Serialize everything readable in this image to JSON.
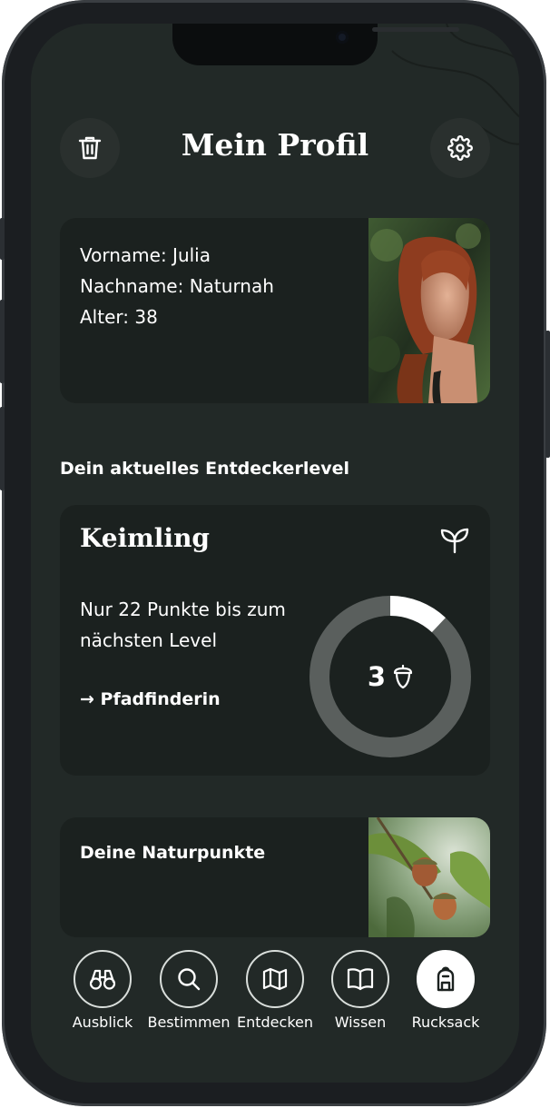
{
  "header": {
    "title": "Mein Profil"
  },
  "profile": {
    "first_name": "Vorname: Julia",
    "last_name": "Nachname: Naturnah",
    "age": "Alter: 38"
  },
  "level_section": {
    "heading": "Dein aktuelles Entdeckerlevel",
    "level_name": "Keimling",
    "description": "Nur 22 Punkte bis zum nächsten Level",
    "next_level": "→ Pfadfinderin",
    "current_level": "3",
    "progress_fraction": 0.12
  },
  "points_card": {
    "title": "Deine Naturpunkte"
  },
  "nav": {
    "items": [
      {
        "label": "Ausblick",
        "icon": "binoculars-icon"
      },
      {
        "label": "Bestimmen",
        "icon": "search-icon"
      },
      {
        "label": "Entdecken",
        "icon": "map-icon"
      },
      {
        "label": "Wissen",
        "icon": "book-icon"
      },
      {
        "label": "Rucksack",
        "icon": "backpack-icon"
      }
    ],
    "active": "Rucksack"
  },
  "colors": {
    "background": "#222927",
    "card": "#1b211f",
    "ring_track": "#5a5f5d",
    "ring_fill": "#ffffff"
  }
}
